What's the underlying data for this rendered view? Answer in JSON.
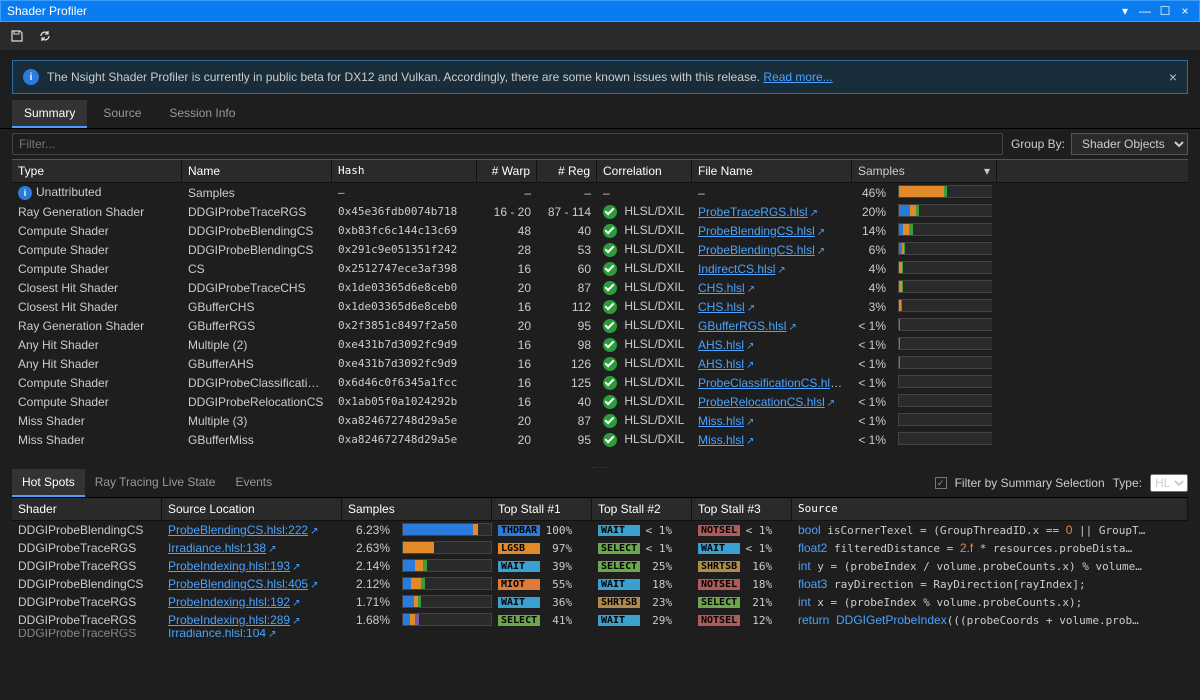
{
  "window": {
    "title": "Shader Profiler"
  },
  "notice": {
    "text": "The Nsight Shader Profiler is currently in public beta for DX12 and Vulkan. Accordingly, there are some known issues with this release. ",
    "link": "Read more..."
  },
  "tabs": {
    "summary": "Summary",
    "source": "Source",
    "session": "Session Info"
  },
  "filter": {
    "placeholder": "Filter...",
    "groupby_label": "Group By:",
    "groupby_value": "Shader Objects"
  },
  "columns": {
    "type": "Type",
    "name": "Name",
    "hash": "Hash",
    "warp": "# Warp",
    "reg": "# Reg",
    "corr": "Correlation",
    "file": "File Name",
    "samples": "Samples"
  },
  "rows": [
    {
      "type": "Unattributed",
      "name": "Samples",
      "hash": "–",
      "warp": "–",
      "reg": "–",
      "corr": null,
      "file": "–",
      "pct": "46%",
      "bar": [
        [
          "#e28a2a",
          46
        ],
        [
          "#3a9c3a",
          3
        ]
      ]
    },
    {
      "type": "Ray Generation Shader",
      "name": "DDGIProbeTraceRGS",
      "hash": "0x45e36fdb0074b718",
      "warp": "16 - 20",
      "reg": "87 - 114",
      "corr": "HLSL/DXIL",
      "file": "ProbeTraceRGS.hlsl",
      "pct": "20%",
      "bar": [
        [
          "#2a7bdc",
          11
        ],
        [
          "#e28a2a",
          6
        ],
        [
          "#3a9c3a",
          3
        ]
      ]
    },
    {
      "type": "Compute Shader",
      "name": "DDGIProbeBlendingCS",
      "hash": "0xb83fc6c144c13c69",
      "warp": "48",
      "reg": "40",
      "corr": "HLSL/DXIL",
      "file": "ProbeBlendingCS.hlsl",
      "pct": "14%",
      "bar": [
        [
          "#2a7bdc",
          4
        ],
        [
          "#e28a2a",
          6
        ],
        [
          "#3a9c3a",
          4
        ]
      ]
    },
    {
      "type": "Compute Shader",
      "name": "DDGIProbeBlendingCS",
      "hash": "0x291c9e051351f242",
      "warp": "28",
      "reg": "53",
      "corr": "HLSL/DXIL",
      "file": "ProbeBlendingCS.hlsl",
      "pct": "6%",
      "bar": [
        [
          "#2a7bdc",
          3
        ],
        [
          "#e28a2a",
          2
        ],
        [
          "#3a9c3a",
          1
        ]
      ]
    },
    {
      "type": "Compute Shader",
      "name": "CS",
      "hash": "0x2512747ece3af398",
      "warp": "16",
      "reg": "60",
      "corr": "HLSL/DXIL",
      "file": "IndirectCS.hlsl",
      "pct": "4%",
      "bar": [
        [
          "#e28a2a",
          3
        ],
        [
          "#3a9c3a",
          1
        ]
      ]
    },
    {
      "type": "Closest Hit Shader",
      "name": "DDGIProbeTraceCHS",
      "hash": "0x1de03365d6e8ceb0",
      "warp": "20",
      "reg": "87",
      "corr": "HLSL/DXIL",
      "file": "CHS.hlsl",
      "pct": "4%",
      "bar": [
        [
          "#e28a2a",
          3
        ],
        [
          "#3a9c3a",
          1
        ]
      ]
    },
    {
      "type": "Closest Hit Shader",
      "name": "GBufferCHS",
      "hash": "0x1de03365d6e8ceb0",
      "warp": "16",
      "reg": "112",
      "corr": "HLSL/DXIL",
      "file": "CHS.hlsl",
      "pct": "3%",
      "bar": [
        [
          "#e28a2a",
          2
        ],
        [
          "#3a9c3a",
          1
        ]
      ]
    },
    {
      "type": "Ray Generation Shader",
      "name": "GBufferRGS",
      "hash": "0x2f3851c8497f2a50",
      "warp": "20",
      "reg": "95",
      "corr": "HLSL/DXIL",
      "file": "GBufferRGS.hlsl",
      "pct": "<  1%",
      "bar": [
        [
          "#3a9c3a",
          1
        ]
      ]
    },
    {
      "type": "Any Hit Shader",
      "name": "Multiple (2)",
      "hash": "0xe431b7d3092fc9d9",
      "warp": "16",
      "reg": "98",
      "corr": "HLSL/DXIL",
      "file": "AHS.hlsl",
      "pct": "<  1%",
      "bar": [
        [
          "#3a9c3a",
          1
        ]
      ]
    },
    {
      "type": "Any Hit Shader",
      "name": "GBufferAHS",
      "hash": "0xe431b7d3092fc9d9",
      "warp": "16",
      "reg": "126",
      "corr": "HLSL/DXIL",
      "file": "AHS.hlsl",
      "pct": "<  1%",
      "bar": [
        [
          "#3a9c3a",
          1
        ]
      ]
    },
    {
      "type": "Compute Shader",
      "name": "DDGIProbeClassificationCS",
      "hash": "0x6d46c0f6345a1fcc",
      "warp": "16",
      "reg": "125",
      "corr": "HLSL/DXIL",
      "file": "ProbeClassificationCS.hlsl",
      "pct": "<  1%",
      "bar": []
    },
    {
      "type": "Compute Shader",
      "name": "DDGIProbeRelocationCS",
      "hash": "0x1ab05f0a1024292b",
      "warp": "16",
      "reg": "40",
      "corr": "HLSL/DXIL",
      "file": "ProbeRelocationCS.hlsl",
      "pct": "<  1%",
      "bar": []
    },
    {
      "type": "Miss Shader",
      "name": "Multiple (3)",
      "hash": "0xa824672748d29a5e",
      "warp": "20",
      "reg": "87",
      "corr": "HLSL/DXIL",
      "file": "Miss.hlsl",
      "pct": "<  1%",
      "bar": []
    },
    {
      "type": "Miss Shader",
      "name": "GBufferMiss",
      "hash": "0xa824672748d29a5e",
      "warp": "20",
      "reg": "95",
      "corr": "HLSL/DXIL",
      "file": "Miss.hlsl",
      "pct": "<  1%",
      "bar": []
    }
  ],
  "bottom_tabs": {
    "hotspots": "Hot Spots",
    "rtstate": "Ray Tracing Live State",
    "events": "Events"
  },
  "bottom_right": {
    "filter_label": "Filter by Summary Selection",
    "type_label": "Type:",
    "type_value": "HL"
  },
  "bcols": {
    "shader": "Shader",
    "loc": "Source Location",
    "samples": "Samples",
    "s1": "Top Stall #1",
    "s2": "Top Stall #2",
    "s3": "Top Stall #3",
    "src": "Source"
  },
  "brows": [
    {
      "shader": "DDGIProbeBlendingCS",
      "loc": "ProbeBlendingCS.hlsl:222",
      "pct": "6.23%",
      "bar": [
        [
          "#2a7bdc",
          80
        ],
        [
          "#e28a2a",
          5
        ]
      ],
      "s1": [
        "THDBAR",
        "100%",
        "#2a7bdc"
      ],
      "s2": [
        "WAIT",
        "<  1%",
        "#3aa0d0"
      ],
      "s3": [
        "NOTSEL",
        "<  1%",
        "#b05a5a"
      ],
      "src": "<span class='kw'>bool</span> isCornerTexel = (GroupThreadID.x == <span class='num'>0</span> || GroupT…"
    },
    {
      "shader": "DDGIProbeTraceRGS",
      "loc": "Irradiance.hlsl:138",
      "pct": "2.63%",
      "bar": [
        [
          "#e28a2a",
          35
        ]
      ],
      "s1": [
        "LGSB",
        "97%",
        "#e28a2a"
      ],
      "s2": [
        "SELECT",
        "<  1%",
        "#6aa84a"
      ],
      "s3": [
        "WAIT",
        "<  1%",
        "#3aa0d0"
      ],
      "src": "<span class='kw'>float2</span> filteredDistance = <span class='num'>2.f</span> * resources.probeDista…"
    },
    {
      "shader": "DDGIProbeTraceRGS",
      "loc": "ProbeIndexing.hlsl:193",
      "pct": "2.14%",
      "bar": [
        [
          "#2a7bdc",
          14
        ],
        [
          "#e28a2a",
          9
        ],
        [
          "#3a9c3a",
          4
        ]
      ],
      "s1": [
        "WAIT",
        "39%",
        "#3aa0d0"
      ],
      "s2": [
        "SELECT",
        "25%",
        "#6aa84a"
      ],
      "s3": [
        "SHRTSB",
        "16%",
        "#b08a4a"
      ],
      "src": "<span class='kw'>int</span> y = (probeIndex / volume.probeCounts.x) % volume…"
    },
    {
      "shader": "DDGIProbeBlendingCS",
      "loc": "ProbeBlendingCS.hlsl:405",
      "pct": "2.12%",
      "bar": [
        [
          "#2a7bdc",
          9
        ],
        [
          "#e28a2a",
          12
        ],
        [
          "#3a9c3a",
          4
        ]
      ],
      "s1": [
        "MIOT",
        "55%",
        "#e07a3a"
      ],
      "s2": [
        "WAIT",
        "18%",
        "#3aa0d0"
      ],
      "s3": [
        "NOTSEL",
        "18%",
        "#b05a5a"
      ],
      "src": "<span class='kw'>float3</span> rayDirection = RayDirection[rayIndex];"
    },
    {
      "shader": "DDGIProbeTraceRGS",
      "loc": "ProbeIndexing.hlsl:192",
      "pct": "1.71%",
      "bar": [
        [
          "#2a7bdc",
          12
        ],
        [
          "#e28a2a",
          5
        ],
        [
          "#3a9c3a",
          4
        ]
      ],
      "s1": [
        "WAIT",
        "36%",
        "#3aa0d0"
      ],
      "s2": [
        "SHRTSB",
        "23%",
        "#b08a4a"
      ],
      "s3": [
        "SELECT",
        "21%",
        "#6aa84a"
      ],
      "src": "<span class='kw'>int</span> x = (probeIndex % volume.probeCounts.x);"
    },
    {
      "shader": "DDGIProbeTraceRGS",
      "loc": "ProbeIndexing.hlsl:289",
      "pct": "1.68%",
      "bar": [
        [
          "#2a7bdc",
          8
        ],
        [
          "#e28a2a",
          6
        ],
        [
          "#7a5aa0",
          4
        ]
      ],
      "s1": [
        "SELECT",
        "41%",
        "#6aa84a"
      ],
      "s2": [
        "WAIT",
        "29%",
        "#3aa0d0"
      ],
      "s3": [
        "NOTSEL",
        "12%",
        "#b05a5a"
      ],
      "src": "<span class='kw'>return</span> <span class='fn'>DDGIGetProbeIndex</span>(((probeCoords + volume.prob…"
    }
  ]
}
